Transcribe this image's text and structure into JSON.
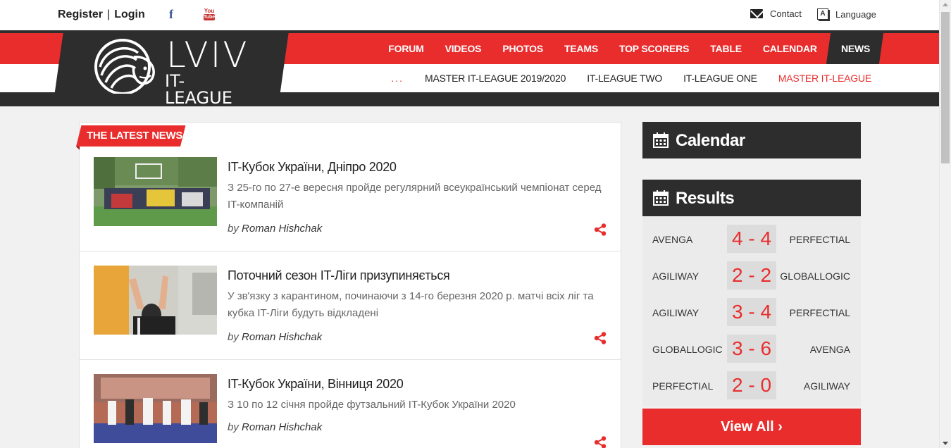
{
  "topbar": {
    "register": "Register",
    "separator": "|",
    "login": "Login",
    "facebook_glyph": "f",
    "youtube_you": "You",
    "youtube_tube": "Tube",
    "contact": "Contact",
    "language": "Language",
    "language_glyph": "A"
  },
  "logo": {
    "line1": "LVIV",
    "line2": "IT-LEAGUE"
  },
  "mainnav": {
    "items": [
      "FORUM",
      "VIDEOS",
      "PHOTOS",
      "TEAMS",
      "TOP SCORERS",
      "TABLE",
      "CALENDAR",
      "NEWS"
    ],
    "active": "NEWS"
  },
  "subnav": {
    "dots": "...",
    "items": [
      "MASTER IT-LEAGUE 2019/2020",
      "IT-LEAGUE TWO",
      "IT-LEAGUE ONE",
      "MASTER IT-LEAGUE"
    ]
  },
  "news": {
    "heading": "THE LATEST NEWS",
    "articles": [
      {
        "title": "IT-Кубок України, Дніпро 2020",
        "desc": "З 25-го по 27-е вересня пройде регулярний всеукраїнський чемпіонат серед IT-компаній",
        "by": "by",
        "author": "Roman Hishchak"
      },
      {
        "title": "Поточний сезон IT-Ліги призупиняється",
        "desc": "У зв'язку з карантином, починаючи з 14-го березня 2020 р. матчі всіх ліг та кубка IT-Ліги будуть відкладені",
        "by": "by",
        "author": "Roman Hishchak"
      },
      {
        "title": "IT-Кубок України, Вінниця 2020",
        "desc": "З 10 по 12 січня пройде футзальний IT-Кубок України 2020",
        "by": "by",
        "author": "Roman Hishchak"
      }
    ]
  },
  "calendar": {
    "title": "Calendar"
  },
  "results": {
    "title": "Results",
    "rows": [
      {
        "home": "AVENGA",
        "score": "4 - 4",
        "away": "PERFECTIAL"
      },
      {
        "home": "AGILIWAY",
        "score": "2 - 2",
        "away": "GLOBALLOGIC"
      },
      {
        "home": "AGILIWAY",
        "score": "3 - 4",
        "away": "PERFECTIAL"
      },
      {
        "home": "GLOBALLOGIC",
        "score": "3 - 6",
        "away": "AVENGA"
      },
      {
        "home": "PERFECTIAL",
        "score": "2 - 0",
        "away": "AGILIWAY"
      }
    ],
    "view_all": "View All ›"
  },
  "colors": {
    "accent": "#e92d2d",
    "dark": "#2d2d2d"
  }
}
